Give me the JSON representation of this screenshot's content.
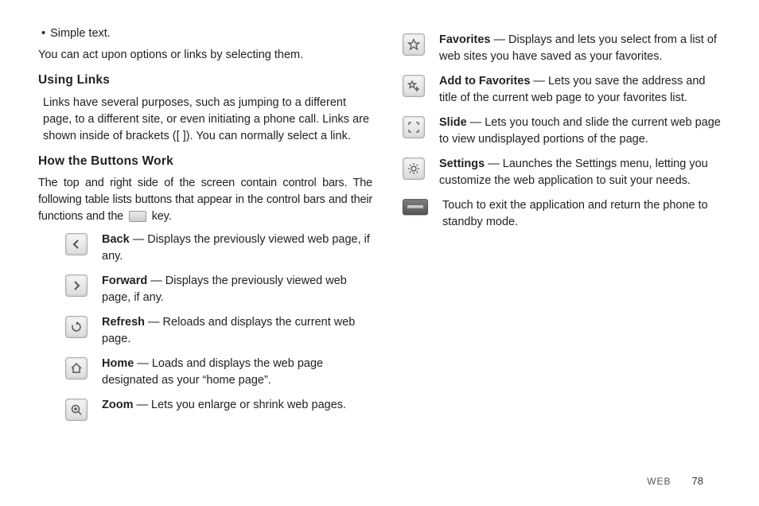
{
  "left": {
    "bullet": "Simple text.",
    "act_para": "You can act upon options or links by selecting them.",
    "heading_links": "Using Links",
    "links_para": "Links have several purposes, such as jumping to a different page, to a different site, or even initiating a phone call. Links are shown inside of brackets ([   ]). You can normally select a link.",
    "heading_buttons": "How the Buttons Work",
    "buttons_intro_a": "The top and right side of the screen contain control bars. The following table lists buttons that appear in the control bars and their functions and the ",
    "buttons_intro_b": " key.",
    "rows": {
      "back": {
        "term": "Back",
        "desc": " — Displays the previously viewed web page, if any."
      },
      "forward": {
        "term": "Forward",
        "desc": " — Displays the previously viewed web page, if any."
      },
      "refresh": {
        "term": "Refresh",
        "desc": " — Reloads and displays the current web page."
      },
      "home": {
        "term": "Home",
        "desc": " — Loads and displays the web page designated as your “home page”."
      },
      "zoom": {
        "term": "Zoom",
        "desc": " — Lets you enlarge or shrink web pages."
      }
    }
  },
  "right": {
    "rows": {
      "favorites": {
        "term": "Favorites",
        "desc": " — Displays and lets you select from a list of web sites you have saved as your favorites."
      },
      "addfav": {
        "term": "Add to Favorites",
        "desc": " — Lets you save the address and title of the current web page to your favorites list."
      },
      "slide": {
        "term": "Slide",
        "desc": " — Lets you touch and slide the current web page to view undisplayed portions of the page."
      },
      "settings": {
        "term": "Settings",
        "desc": " — Launches the Settings menu, letting you customize the web application to suit your needs."
      },
      "exit": {
        "desc": "Touch to exit the application and return the phone to standby mode."
      }
    }
  },
  "footer": {
    "section": "WEB",
    "page": "78"
  }
}
